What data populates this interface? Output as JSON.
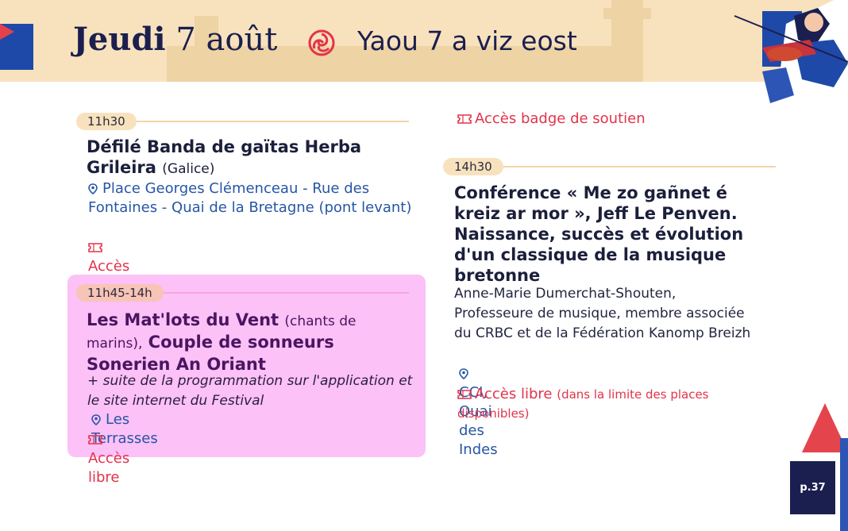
{
  "header": {
    "day_fr": "Jeudi",
    "date_fr": "7 août",
    "date_br": "Yaou 7 a viz eost"
  },
  "column_left": {
    "slot1": {
      "time": "11h30",
      "title": "Défilé Banda de gaïtas Herba Grileira",
      "origin": "(Galice)",
      "location": "Place Georges Clémenceau - Rue des Fontaines - Quai de la Bretagne (pont levant)",
      "access": "Accès libre"
    },
    "slot2": {
      "time": "11h45-14h",
      "title_a": "Les Mat'lots du Vent",
      "paren_a": "(chants de marins),",
      "title_b": "Couple de sonneurs Sonerien An Oriant",
      "note": "+ suite de la programmation sur l'application et le site internet du Festival",
      "location": "Les Terrasses",
      "access": "Accès libre"
    }
  },
  "column_right": {
    "top_access": "Accès badge de soutien",
    "slot1": {
      "time": "14h30",
      "title": "Conférence « Me zo gañnet é kreiz ar mor », Jeff Le Penven. Naissance, succès et évolution d'un classique de la musique bretonne",
      "speaker": "Anne-Marie Dumerchat-Shouten, Professeure de musique, membre associée du CRBC et de la Fédération Kanomp Breizh",
      "location": "CCI, Quai des Indes",
      "access": "Accès libre",
      "access_note": "(dans la limite des places disponibles)"
    }
  },
  "footer": {
    "page": "p.37"
  },
  "colors": {
    "header_bg": "#f8e2bd",
    "pink_box": "#fcc1f7",
    "location_blue": "#2656a5",
    "access_red": "#e2334a",
    "navy": "#1b1f4f"
  }
}
